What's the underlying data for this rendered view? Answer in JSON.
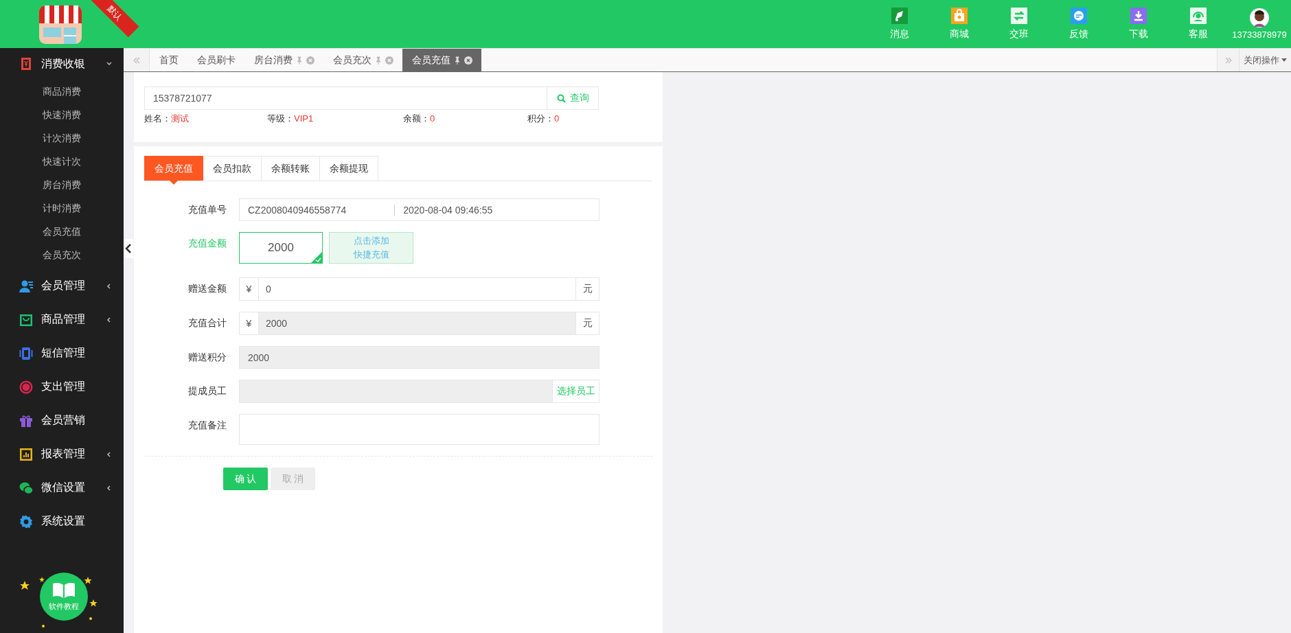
{
  "header": {
    "ribbon": "默认",
    "nav": [
      {
        "label": "消息"
      },
      {
        "label": "商城"
      },
      {
        "label": "交班"
      },
      {
        "label": "反馈"
      },
      {
        "label": "下载"
      },
      {
        "label": "客服"
      }
    ],
    "user": "13733878979"
  },
  "sidebar": {
    "items": [
      {
        "label": "消费收银",
        "color": "#e0433a",
        "expanded": true,
        "children": [
          {
            "label": "商品消费"
          },
          {
            "label": "快速消费"
          },
          {
            "label": "计次消费"
          },
          {
            "label": "快速计次"
          },
          {
            "label": "房台消费"
          },
          {
            "label": "计时消费"
          },
          {
            "label": "会员充值"
          },
          {
            "label": "会员充次"
          }
        ]
      },
      {
        "label": "会员管理",
        "color": "#2f9be6",
        "expanded": false
      },
      {
        "label": "商品管理",
        "color": "#1fbf7a",
        "expanded": false
      },
      {
        "label": "短信管理",
        "color": "#3b6fe0"
      },
      {
        "label": "支出管理",
        "color": "#d6264e"
      },
      {
        "label": "会员营销",
        "color": "#8b5ad6"
      },
      {
        "label": "报表管理",
        "color": "#e8b416",
        "expanded": false
      },
      {
        "label": "微信设置",
        "color": "#1fb45a",
        "expanded": false
      },
      {
        "label": "系统设置",
        "color": "#2f9be6"
      }
    ],
    "tutorial": "软件教程"
  },
  "tabs": [
    {
      "label": "首页",
      "pinned": false,
      "closable": false,
      "selected": false
    },
    {
      "label": "会员刷卡",
      "pinned": false,
      "closable": false,
      "selected": false
    },
    {
      "label": "房台消费",
      "pinned": true,
      "closable": true,
      "selected": false
    },
    {
      "label": "会员充次",
      "pinned": true,
      "closable": true,
      "selected": false
    },
    {
      "label": "会员充值",
      "pinned": true,
      "closable": true,
      "selected": true
    }
  ],
  "close_menu": "关闭操作",
  "member_search": {
    "value": "15378721077",
    "button": "查询",
    "info": [
      {
        "label": "姓名：",
        "value": "测试"
      },
      {
        "label": "等级：",
        "value": "VIP1"
      },
      {
        "label": "余额：",
        "value": "0"
      },
      {
        "label": "积分：",
        "value": "0"
      }
    ]
  },
  "sub_tabs": [
    {
      "label": "会员充值",
      "selected": true
    },
    {
      "label": "会员扣款",
      "selected": false
    },
    {
      "label": "余额转账",
      "selected": false
    },
    {
      "label": "余额提现",
      "selected": false
    }
  ],
  "form": {
    "rows": [
      {
        "kind": "pair",
        "label": "充值单号",
        "highlighted": false,
        "value": "CZ2008040946558774",
        "value_2": "2020-08-04 09:46:55"
      },
      {
        "kind": "amount",
        "label": "充值金额",
        "highlighted": true,
        "amount": {
          "value": "2000",
          "selected": true
        },
        "quick_add": [
          "点击添加",
          "快捷充值"
        ]
      },
      {
        "kind": "currency",
        "label": "赠送金额",
        "highlighted": false,
        "prefix": "¥",
        "value": "0",
        "suffix": "元",
        "readonly": false
      },
      {
        "kind": "currency",
        "label": "充值合计",
        "highlighted": false,
        "prefix": "¥",
        "value": "2000",
        "suffix": "元",
        "readonly": true
      },
      {
        "kind": "plain",
        "label": "赠送积分",
        "highlighted": false,
        "value": "2000",
        "readonly": true
      },
      {
        "kind": "picker",
        "label": "提成员工",
        "highlighted": false,
        "button": "选择员工"
      },
      {
        "kind": "textarea",
        "label": "充值备注",
        "highlighted": false
      }
    ],
    "buttons": [
      {
        "label": "确 认",
        "disabled": false
      },
      {
        "label": "取 消",
        "disabled": true
      }
    ]
  }
}
